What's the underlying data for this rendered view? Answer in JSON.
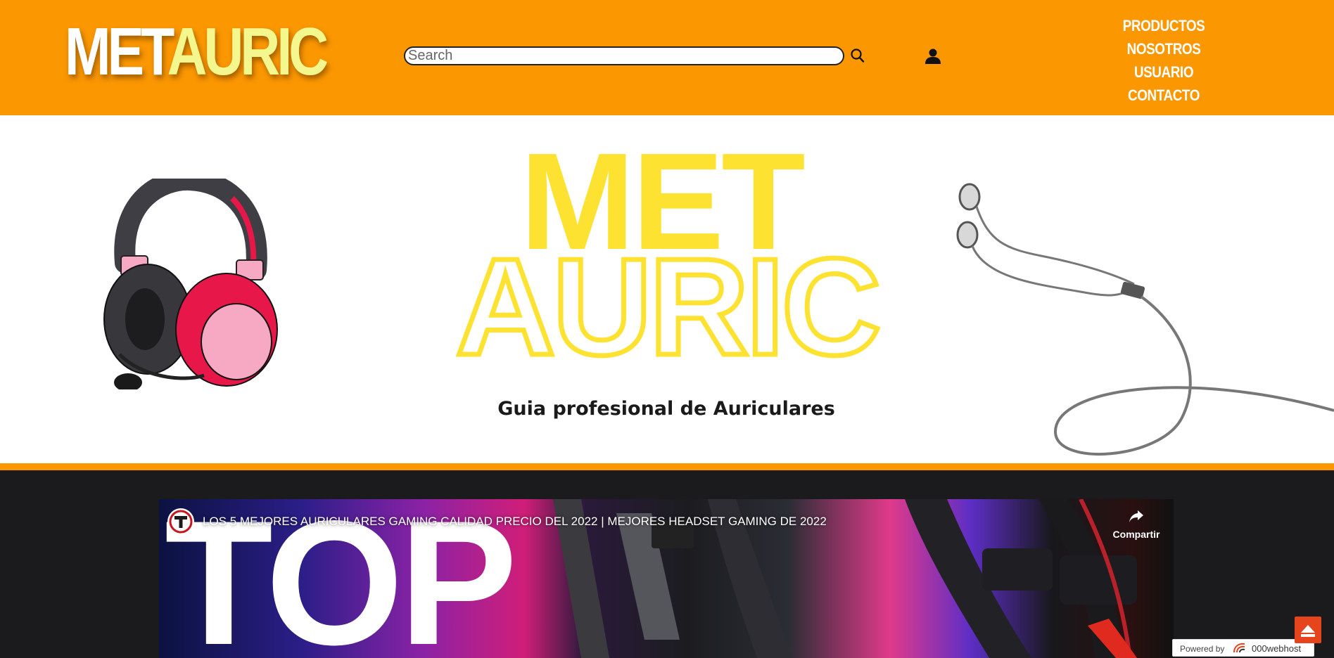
{
  "header": {
    "logo_part1": "MET",
    "logo_part2": "AURIC",
    "search_placeholder": "Search",
    "nav": [
      "PRODUCTOS",
      "NOSOTROS",
      "USUARIO",
      "CONTACTO"
    ]
  },
  "hero": {
    "line1": "MET",
    "line2": "AURIC",
    "subtitle": "Guia profesional de Auriculares"
  },
  "video": {
    "title": "LOS 5 MEJORES AURICULARES GAMING CALIDAD PRECIO DEL 2022 | MEJORES HEADSET GAMING DE 2022",
    "thumbnail_text": "TOP",
    "share_label": "Compartir"
  },
  "footer_badge": {
    "powered_by": "Powered by",
    "brand": "000webhost"
  },
  "colors": {
    "header_bg": "#fb9701",
    "logo_accent": "#f4f78d",
    "hero_yellow": "#fde231",
    "dark_bg": "#1b1b1d",
    "scroll_top": "#e6441c"
  },
  "icons": [
    "search-icon",
    "user-icon",
    "share-icon",
    "scroll-top-icon"
  ]
}
